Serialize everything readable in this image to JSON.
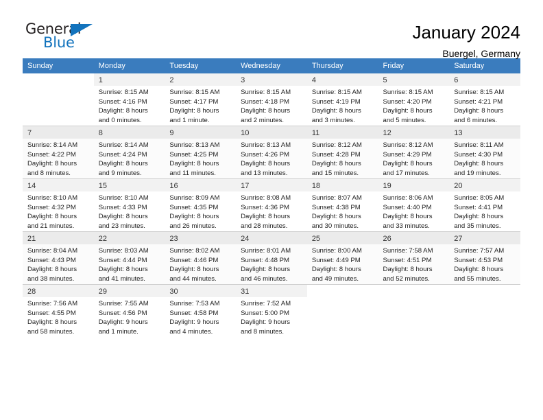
{
  "brand": {
    "name_top": "General",
    "name_bottom": "Blue",
    "accent_color": "#1273bd"
  },
  "header": {
    "title": "January 2024",
    "subtitle": "Buergel, Germany"
  },
  "calendar": {
    "header_color": "#3a7cbe",
    "weekday_headers": [
      "Sunday",
      "Monday",
      "Tuesday",
      "Wednesday",
      "Thursday",
      "Friday",
      "Saturday"
    ],
    "weeks": [
      [
        {
          "day": "",
          "sunrise": "",
          "sunset": "",
          "daylight1": "",
          "daylight2": ""
        },
        {
          "day": "1",
          "sunrise": "Sunrise: 8:15 AM",
          "sunset": "Sunset: 4:16 PM",
          "daylight1": "Daylight: 8 hours",
          "daylight2": "and 0 minutes."
        },
        {
          "day": "2",
          "sunrise": "Sunrise: 8:15 AM",
          "sunset": "Sunset: 4:17 PM",
          "daylight1": "Daylight: 8 hours",
          "daylight2": "and 1 minute."
        },
        {
          "day": "3",
          "sunrise": "Sunrise: 8:15 AM",
          "sunset": "Sunset: 4:18 PM",
          "daylight1": "Daylight: 8 hours",
          "daylight2": "and 2 minutes."
        },
        {
          "day": "4",
          "sunrise": "Sunrise: 8:15 AM",
          "sunset": "Sunset: 4:19 PM",
          "daylight1": "Daylight: 8 hours",
          "daylight2": "and 3 minutes."
        },
        {
          "day": "5",
          "sunrise": "Sunrise: 8:15 AM",
          "sunset": "Sunset: 4:20 PM",
          "daylight1": "Daylight: 8 hours",
          "daylight2": "and 5 minutes."
        },
        {
          "day": "6",
          "sunrise": "Sunrise: 8:15 AM",
          "sunset": "Sunset: 4:21 PM",
          "daylight1": "Daylight: 8 hours",
          "daylight2": "and 6 minutes."
        }
      ],
      [
        {
          "day": "7",
          "sunrise": "Sunrise: 8:14 AM",
          "sunset": "Sunset: 4:22 PM",
          "daylight1": "Daylight: 8 hours",
          "daylight2": "and 8 minutes."
        },
        {
          "day": "8",
          "sunrise": "Sunrise: 8:14 AM",
          "sunset": "Sunset: 4:24 PM",
          "daylight1": "Daylight: 8 hours",
          "daylight2": "and 9 minutes."
        },
        {
          "day": "9",
          "sunrise": "Sunrise: 8:13 AM",
          "sunset": "Sunset: 4:25 PM",
          "daylight1": "Daylight: 8 hours",
          "daylight2": "and 11 minutes."
        },
        {
          "day": "10",
          "sunrise": "Sunrise: 8:13 AM",
          "sunset": "Sunset: 4:26 PM",
          "daylight1": "Daylight: 8 hours",
          "daylight2": "and 13 minutes."
        },
        {
          "day": "11",
          "sunrise": "Sunrise: 8:12 AM",
          "sunset": "Sunset: 4:28 PM",
          "daylight1": "Daylight: 8 hours",
          "daylight2": "and 15 minutes."
        },
        {
          "day": "12",
          "sunrise": "Sunrise: 8:12 AM",
          "sunset": "Sunset: 4:29 PM",
          "daylight1": "Daylight: 8 hours",
          "daylight2": "and 17 minutes."
        },
        {
          "day": "13",
          "sunrise": "Sunrise: 8:11 AM",
          "sunset": "Sunset: 4:30 PM",
          "daylight1": "Daylight: 8 hours",
          "daylight2": "and 19 minutes."
        }
      ],
      [
        {
          "day": "14",
          "sunrise": "Sunrise: 8:10 AM",
          "sunset": "Sunset: 4:32 PM",
          "daylight1": "Daylight: 8 hours",
          "daylight2": "and 21 minutes."
        },
        {
          "day": "15",
          "sunrise": "Sunrise: 8:10 AM",
          "sunset": "Sunset: 4:33 PM",
          "daylight1": "Daylight: 8 hours",
          "daylight2": "and 23 minutes."
        },
        {
          "day": "16",
          "sunrise": "Sunrise: 8:09 AM",
          "sunset": "Sunset: 4:35 PM",
          "daylight1": "Daylight: 8 hours",
          "daylight2": "and 26 minutes."
        },
        {
          "day": "17",
          "sunrise": "Sunrise: 8:08 AM",
          "sunset": "Sunset: 4:36 PM",
          "daylight1": "Daylight: 8 hours",
          "daylight2": "and 28 minutes."
        },
        {
          "day": "18",
          "sunrise": "Sunrise: 8:07 AM",
          "sunset": "Sunset: 4:38 PM",
          "daylight1": "Daylight: 8 hours",
          "daylight2": "and 30 minutes."
        },
        {
          "day": "19",
          "sunrise": "Sunrise: 8:06 AM",
          "sunset": "Sunset: 4:40 PM",
          "daylight1": "Daylight: 8 hours",
          "daylight2": "and 33 minutes."
        },
        {
          "day": "20",
          "sunrise": "Sunrise: 8:05 AM",
          "sunset": "Sunset: 4:41 PM",
          "daylight1": "Daylight: 8 hours",
          "daylight2": "and 35 minutes."
        }
      ],
      [
        {
          "day": "21",
          "sunrise": "Sunrise: 8:04 AM",
          "sunset": "Sunset: 4:43 PM",
          "daylight1": "Daylight: 8 hours",
          "daylight2": "and 38 minutes."
        },
        {
          "day": "22",
          "sunrise": "Sunrise: 8:03 AM",
          "sunset": "Sunset: 4:44 PM",
          "daylight1": "Daylight: 8 hours",
          "daylight2": "and 41 minutes."
        },
        {
          "day": "23",
          "sunrise": "Sunrise: 8:02 AM",
          "sunset": "Sunset: 4:46 PM",
          "daylight1": "Daylight: 8 hours",
          "daylight2": "and 44 minutes."
        },
        {
          "day": "24",
          "sunrise": "Sunrise: 8:01 AM",
          "sunset": "Sunset: 4:48 PM",
          "daylight1": "Daylight: 8 hours",
          "daylight2": "and 46 minutes."
        },
        {
          "day": "25",
          "sunrise": "Sunrise: 8:00 AM",
          "sunset": "Sunset: 4:49 PM",
          "daylight1": "Daylight: 8 hours",
          "daylight2": "and 49 minutes."
        },
        {
          "day": "26",
          "sunrise": "Sunrise: 7:58 AM",
          "sunset": "Sunset: 4:51 PM",
          "daylight1": "Daylight: 8 hours",
          "daylight2": "and 52 minutes."
        },
        {
          "day": "27",
          "sunrise": "Sunrise: 7:57 AM",
          "sunset": "Sunset: 4:53 PM",
          "daylight1": "Daylight: 8 hours",
          "daylight2": "and 55 minutes."
        }
      ],
      [
        {
          "day": "28",
          "sunrise": "Sunrise: 7:56 AM",
          "sunset": "Sunset: 4:55 PM",
          "daylight1": "Daylight: 8 hours",
          "daylight2": "and 58 minutes."
        },
        {
          "day": "29",
          "sunrise": "Sunrise: 7:55 AM",
          "sunset": "Sunset: 4:56 PM",
          "daylight1": "Daylight: 9 hours",
          "daylight2": "and 1 minute."
        },
        {
          "day": "30",
          "sunrise": "Sunrise: 7:53 AM",
          "sunset": "Sunset: 4:58 PM",
          "daylight1": "Daylight: 9 hours",
          "daylight2": "and 4 minutes."
        },
        {
          "day": "31",
          "sunrise": "Sunrise: 7:52 AM",
          "sunset": "Sunset: 5:00 PM",
          "daylight1": "Daylight: 9 hours",
          "daylight2": "and 8 minutes."
        },
        {
          "day": "",
          "sunrise": "",
          "sunset": "",
          "daylight1": "",
          "daylight2": ""
        },
        {
          "day": "",
          "sunrise": "",
          "sunset": "",
          "daylight1": "",
          "daylight2": ""
        },
        {
          "day": "",
          "sunrise": "",
          "sunset": "",
          "daylight1": "",
          "daylight2": ""
        }
      ]
    ]
  }
}
